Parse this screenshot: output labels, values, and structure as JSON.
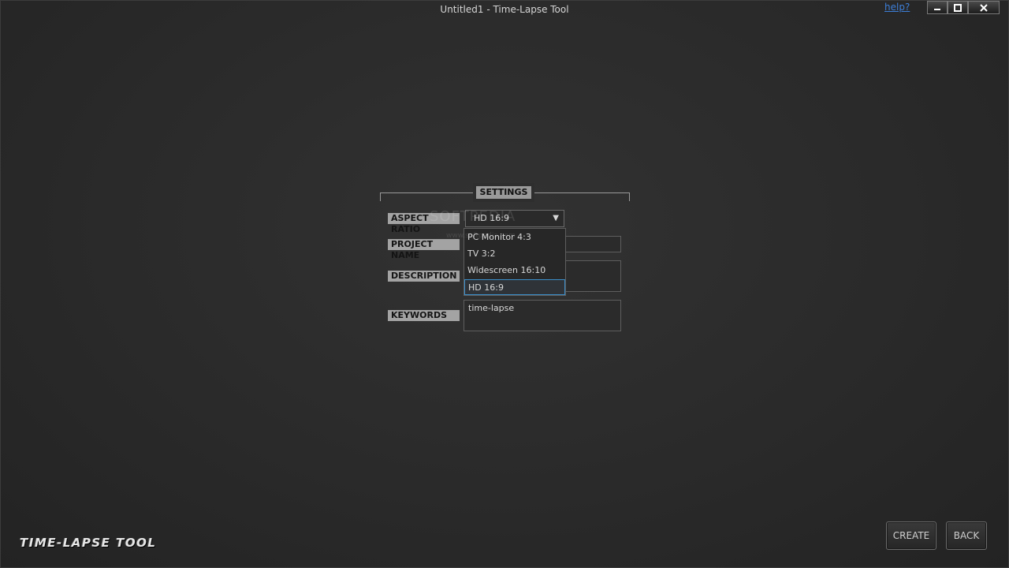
{
  "window": {
    "title": "Untitled1 - Time-Lapse Tool",
    "help_label": "help?",
    "controls": [
      "minimize-icon",
      "maximize-icon",
      "close-icon"
    ]
  },
  "settings": {
    "group_label": "SETTINGS",
    "aspect_ratio": {
      "label": "ASPECT RATIO",
      "selected": "HD 16:9",
      "options": [
        "PC Monitor 4:3",
        "TV 3:2",
        "Widescreen 16:10",
        "HD 16:9"
      ]
    },
    "project_name": {
      "label": "PROJECT NAME",
      "value": ""
    },
    "description": {
      "label": "DESCRIPTION",
      "value": ""
    },
    "keywords": {
      "label": "KEYWORDS",
      "value": "time-lapse"
    }
  },
  "watermark": {
    "text": "SOFTPEDIA",
    "sub": "www.softpedia.com"
  },
  "footer": {
    "brand": "TIME-LAPSE TOOL",
    "create_label": "CREATE",
    "back_label": "BACK"
  },
  "colors": {
    "background": "#2b2b2b",
    "label_bg": "#a3a3a3",
    "selection_border": "#3b8ec9",
    "help_link": "#3d7fd9"
  }
}
